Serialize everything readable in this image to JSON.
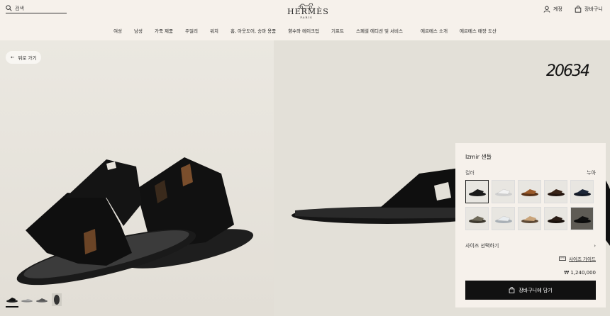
{
  "header": {
    "search_placeholder": "검색",
    "brand": "HERMÈS",
    "brand_city": "PARIS",
    "account_label": "계정",
    "cart_label": "장바구니"
  },
  "nav": {
    "items": [
      "여성",
      "남성",
      "가죽 제품",
      "주얼리",
      "워치",
      "홈, 아웃도어, 승마 용품",
      "향수와 메이크업",
      "기프트",
      "스페셜 에디션 및 서비스"
    ],
    "secondary": [
      "에르메스 소개",
      "에르메스 매장 도산"
    ]
  },
  "back_label": "뒤로 가기",
  "watermark": "20634",
  "product": {
    "name": "Izmir 샌들",
    "color_label": "컬러",
    "color_value": "누아",
    "size_label": "사이즈 선택하기",
    "size_guide_label": "사이즈 가이드",
    "price": "₩ 1,240,000",
    "add_to_cart_label": "장바구니에 담기",
    "swatch_colors": [
      "#1a1a1a",
      "#f2f2f2",
      "#9a5a2a",
      "#3a2418",
      "#1c2638",
      "#6f6a5a",
      "#e8ecef",
      "#c9a47a",
      "#2a1d16",
      "#101010"
    ]
  },
  "colors": {
    "background": "#f6f1eb",
    "button": "#111111",
    "button_text": "#ffffff"
  }
}
